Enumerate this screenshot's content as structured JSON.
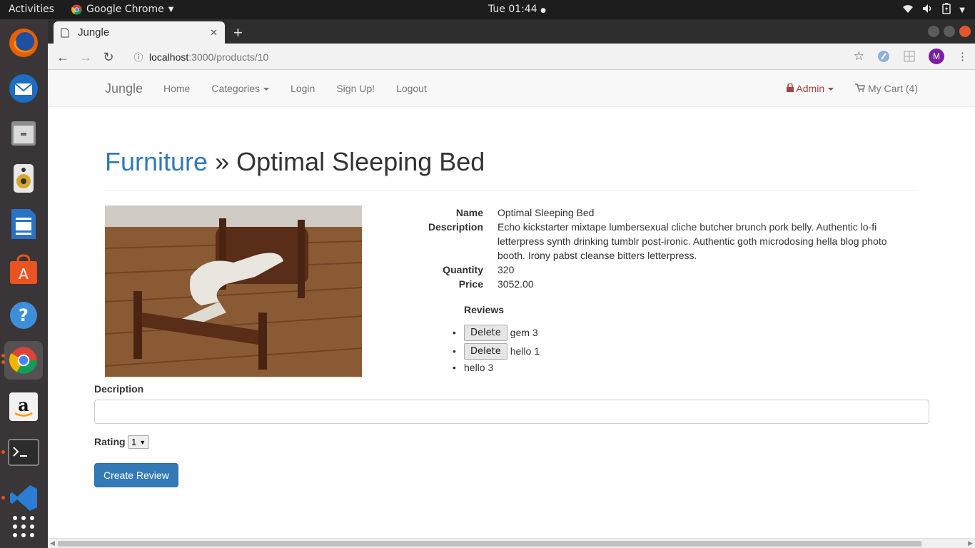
{
  "system": {
    "activities": "Activities",
    "app_name": "Google Chrome",
    "clock": "Tue 01:44"
  },
  "browser": {
    "tab_title": "Jungle",
    "url_host": "localhost",
    "url_path": ":3000/products/10",
    "profile_initial": "M"
  },
  "navbar": {
    "brand": "Jungle",
    "links": [
      "Home",
      "Categories",
      "Login",
      "Sign Up!",
      "Logout"
    ],
    "admin": "Admin",
    "cart": "My Cart (4)"
  },
  "product": {
    "category": "Furniture",
    "separator": "»",
    "name": "Optimal Sleeping Bed",
    "details": [
      {
        "label": "Name",
        "value": "Optimal Sleeping Bed"
      },
      {
        "label": "Description",
        "value": "Echo kickstarter mixtape lumbersexual cliche butcher brunch pork belly. Authentic lo-fi letterpress synth drinking tumblr post-ironic. Authentic goth microdosing hella blog photo booth. Irony pabst cleanse bitters letterpress."
      },
      {
        "label": "Quantity",
        "value": "320"
      },
      {
        "label": "Price",
        "value": "3052.00"
      }
    ]
  },
  "reviews": {
    "heading": "Reviews",
    "delete_label": "Delete",
    "items": [
      {
        "text": "gem 3",
        "deletable": true
      },
      {
        "text": "hello 1",
        "deletable": true
      },
      {
        "text": "hello 3",
        "deletable": false
      }
    ]
  },
  "form": {
    "description_label": "Decription",
    "description_value": "",
    "rating_label": "Rating",
    "rating_value": "1",
    "submit_label": "Create Review"
  }
}
